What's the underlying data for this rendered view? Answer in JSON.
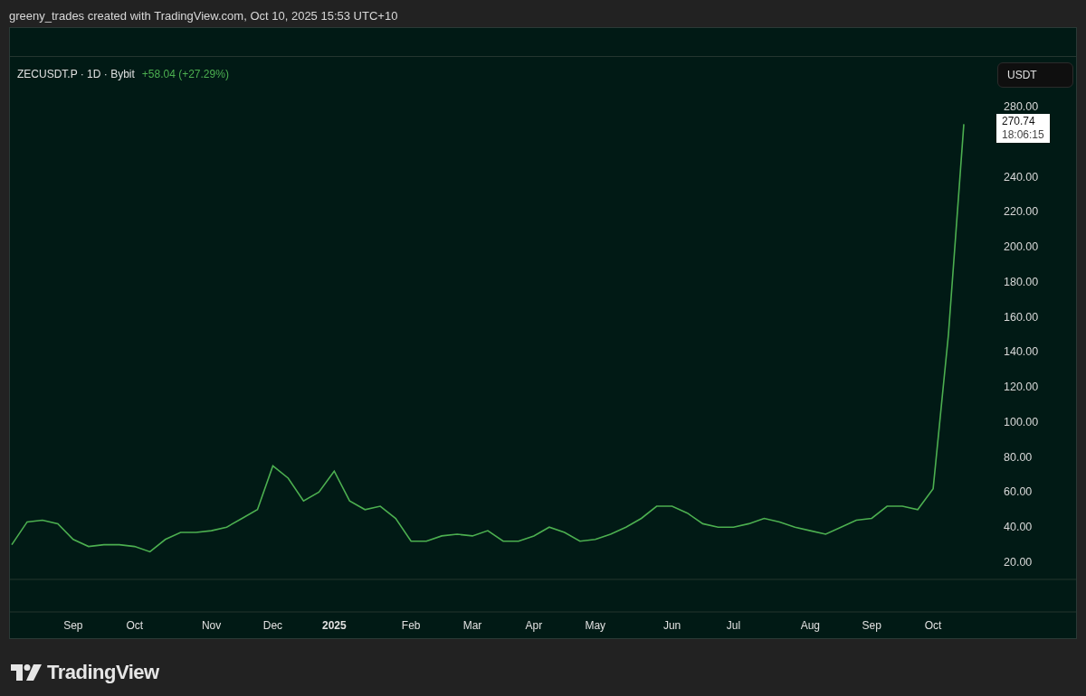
{
  "caption": "greeny_trades created with TradingView.com, Oct 10, 2025 15:53 UTC+10",
  "header": {
    "symbol": "ZECUSDT.P · 1D · Bybit",
    "change": "+58.04 (+27.29%)"
  },
  "currency_button": "USDT",
  "last_price": {
    "value": "270.74",
    "countdown": "18:06:15"
  },
  "chart_data": {
    "type": "line",
    "categories": [
      null,
      null,
      null,
      null,
      "Sep",
      null,
      null,
      null,
      "Oct",
      null,
      null,
      null,
      null,
      "Nov",
      null,
      null,
      null,
      "Dec",
      null,
      null,
      null,
      "2025",
      null,
      null,
      null,
      null,
      "Feb",
      null,
      null,
      null,
      "Mar",
      null,
      null,
      null,
      "Apr",
      null,
      null,
      null,
      "May",
      null,
      null,
      null,
      null,
      "Jun",
      null,
      null,
      null,
      "Jul",
      null,
      null,
      null,
      null,
      "Aug",
      null,
      null,
      null,
      "Sep",
      null,
      null,
      null,
      "Oct",
      null,
      null
    ],
    "series": [
      {
        "color": "#4caf50",
        "values": [
          30,
          43,
          44,
          42,
          33,
          29,
          30,
          30,
          29,
          26,
          33,
          37,
          37,
          38,
          40,
          45,
          50,
          75,
          68,
          55,
          60,
          72,
          55,
          50,
          52,
          45,
          32,
          32,
          35,
          36,
          35,
          38,
          32,
          32,
          35,
          40,
          37,
          32,
          33,
          36,
          40,
          45,
          52,
          52,
          48,
          42,
          40,
          40,
          42,
          45,
          43,
          40,
          38,
          36,
          40,
          44,
          45,
          52,
          52,
          50,
          62,
          150,
          270
        ]
      }
    ],
    "yticks": [
      {
        "value": 20,
        "label": "20.00"
      },
      {
        "value": 40,
        "label": "40.00"
      },
      {
        "value": 60,
        "label": "60.00"
      },
      {
        "value": 80,
        "label": "80.00"
      },
      {
        "value": 100,
        "label": "100.00"
      },
      {
        "value": 120,
        "label": "120.00"
      },
      {
        "value": 140,
        "label": "140.00"
      },
      {
        "value": 160,
        "label": "160.00"
      },
      {
        "value": 180,
        "label": "180.00"
      },
      {
        "value": 200,
        "label": "200.00"
      },
      {
        "value": 220,
        "label": "220.00"
      },
      {
        "value": 240,
        "label": "240.00"
      },
      {
        "value": 280,
        "label": "280.00"
      }
    ],
    "ylim": [
      20,
      280
    ]
  },
  "logo": "TradingView"
}
